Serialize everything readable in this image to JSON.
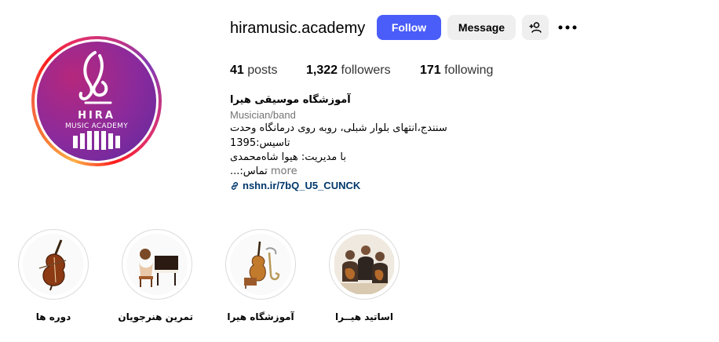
{
  "profile": {
    "username": "hiramusic.academy",
    "follow_label": "Follow",
    "message_label": "Message",
    "logo_hira": "HIRA",
    "logo_sub": "MUSIC ACADEMY"
  },
  "stats": {
    "posts_count": "41",
    "posts_label": "posts",
    "followers_count": "1,322",
    "followers_label": "followers",
    "following_count": "171",
    "following_label": "following"
  },
  "bio": {
    "name": "آموزشگاه موسیقی هیرا",
    "category": "Musician/band",
    "line1": "سنندج،انتهای بلوار شبلی، روبه روی درمانگاه وحدت",
    "line2": "تاسیس:1395",
    "line3": "با مدیریت: هیوا شاه‌محمدی",
    "line4": "تماس:...",
    "more_label": "more",
    "link": "nshn.ir/7bQ_U5_CUNCK"
  },
  "highlights": [
    {
      "label": "دوره ها",
      "icon": "double-bass-icon"
    },
    {
      "label": "تمرین هنرجویان",
      "icon": "piano-student-icon"
    },
    {
      "label": "آموزشگاه هیرا",
      "icon": "instruments-icon"
    },
    {
      "label": "اساتید هیــرا",
      "icon": "orchestra-icon"
    }
  ],
  "colors": {
    "follow_button": "#4a5df9",
    "link": "#00376b",
    "avatar_bg": "#8a2a9c"
  }
}
